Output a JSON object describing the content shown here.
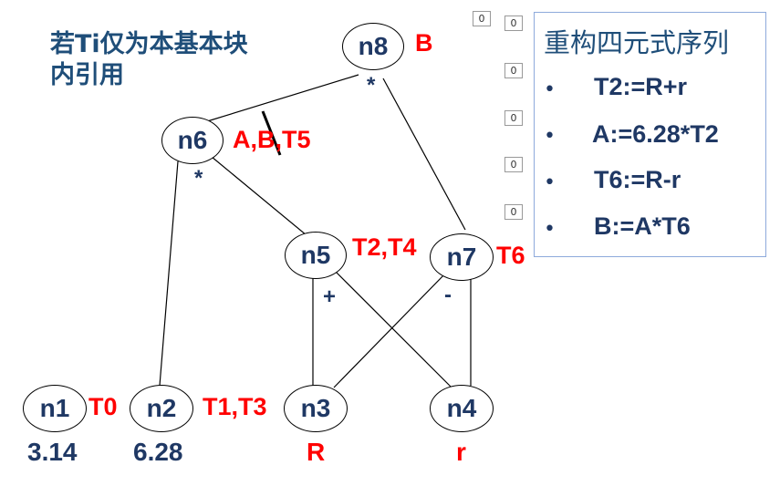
{
  "title_lines": [
    "若Ti仅为本基本块",
    "内引用"
  ],
  "nodes": {
    "n1": {
      "name": "n1",
      "tag": "T0",
      "value": "3.14"
    },
    "n2": {
      "name": "n2",
      "value": "6.28"
    },
    "n3": {
      "name": "n3",
      "tag": "T1,T3",
      "value": "R"
    },
    "n4": {
      "name": "n4",
      "value": "r"
    },
    "n5": {
      "name": "n5",
      "tag": "T2,T4",
      "op": "+"
    },
    "n6": {
      "name": "n6",
      "tag_a": "A,",
      "tag_b": "B",
      "tag_c": ",T5",
      "op": "*"
    },
    "n7": {
      "name": "n7",
      "tag": "T6",
      "op": "-"
    },
    "n8": {
      "name": "n8",
      "tag": "B",
      "op": "*"
    }
  },
  "panel": {
    "title": "重构四元式序列",
    "items": [
      "T2:=R+r",
      "A:=6.28*T2",
      "T6:=R-r",
      "B:=A*T6"
    ],
    "bullet": "•"
  },
  "counters": [
    "0",
    "0",
    "0",
    "0",
    "0",
    "0"
  ],
  "colors": {
    "node_text": "#1f3864",
    "tag": "#ff0000",
    "panel_border": "#8eaadb"
  }
}
